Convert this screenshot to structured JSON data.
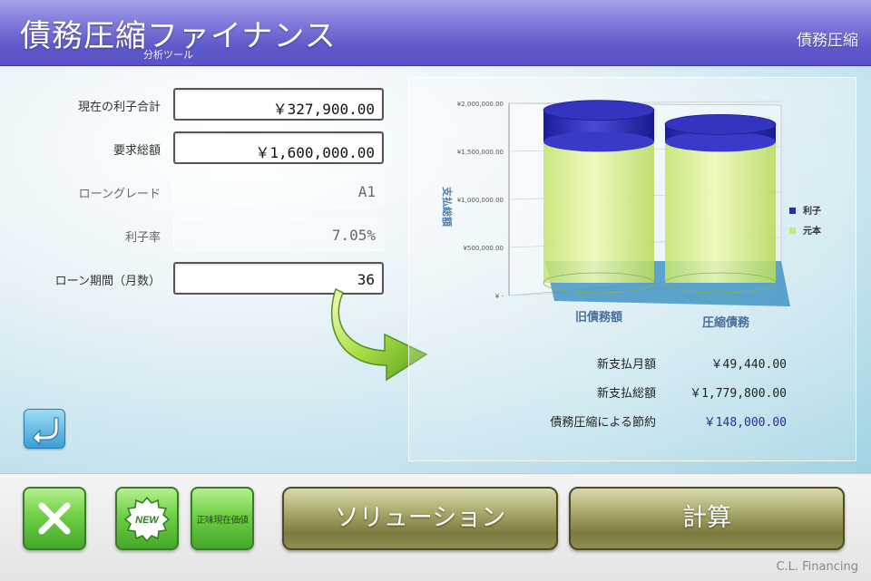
{
  "header": {
    "title": "債務圧縮ファイナンス",
    "subtitle": "分析ツール",
    "right_label": "債務圧縮"
  },
  "form": {
    "fields": [
      {
        "label": "現在の利子合計",
        "value": "￥327,900.00",
        "editable": true
      },
      {
        "label": "要求総額",
        "value": "￥1,600,000.00",
        "editable": true
      },
      {
        "label": "ローングレード",
        "value": "A1",
        "editable": false
      },
      {
        "label": "利子率",
        "value": "7.05%",
        "editable": false
      },
      {
        "label": "ローン期間（月数）",
        "value": "36",
        "editable": true
      }
    ]
  },
  "chart_data": {
    "type": "bar",
    "stacked": true,
    "categories": [
      "旧債務額",
      "圧縮債務"
    ],
    "series": [
      {
        "name": "元本",
        "values": [
          1600000,
          1600000
        ],
        "color": "#d2f08a"
      },
      {
        "name": "利子",
        "values": [
          327900,
          179800
        ],
        "color": "#2a2ab5"
      }
    ],
    "ylabel": "支払総額",
    "ylim": [
      0,
      2000000
    ],
    "yticks": [
      "¥ -",
      "¥500,000.00",
      "¥1,000,000.00",
      "¥1,500,000.00",
      "¥2,000,000.00"
    ],
    "legend": [
      {
        "label": "利子",
        "color": "#2a2ab5"
      },
      {
        "label": "元本",
        "color": "#c6ea79"
      }
    ],
    "legend_position": "right"
  },
  "summary": [
    {
      "label": "新支払月額",
      "value": "￥49,440.00",
      "highlight": false
    },
    {
      "label": "新支払総額",
      "value": "￥1,779,800.00",
      "highlight": false
    },
    {
      "label": "債務圧縮による節約",
      "value": "￥148,000.00",
      "highlight": true
    }
  ],
  "buttons": {
    "new_label": "NEW",
    "pv_label": "正味現在価値",
    "solution_label": "ソリューション",
    "calc_label": "計算"
  },
  "brand": "C.L.   Financing",
  "colors": {
    "header": "#5f5acb",
    "green_button": "#6fcf45",
    "olive_button": "#8e8d52",
    "interest": "#2a2ab5",
    "principal": "#d2f08a"
  }
}
